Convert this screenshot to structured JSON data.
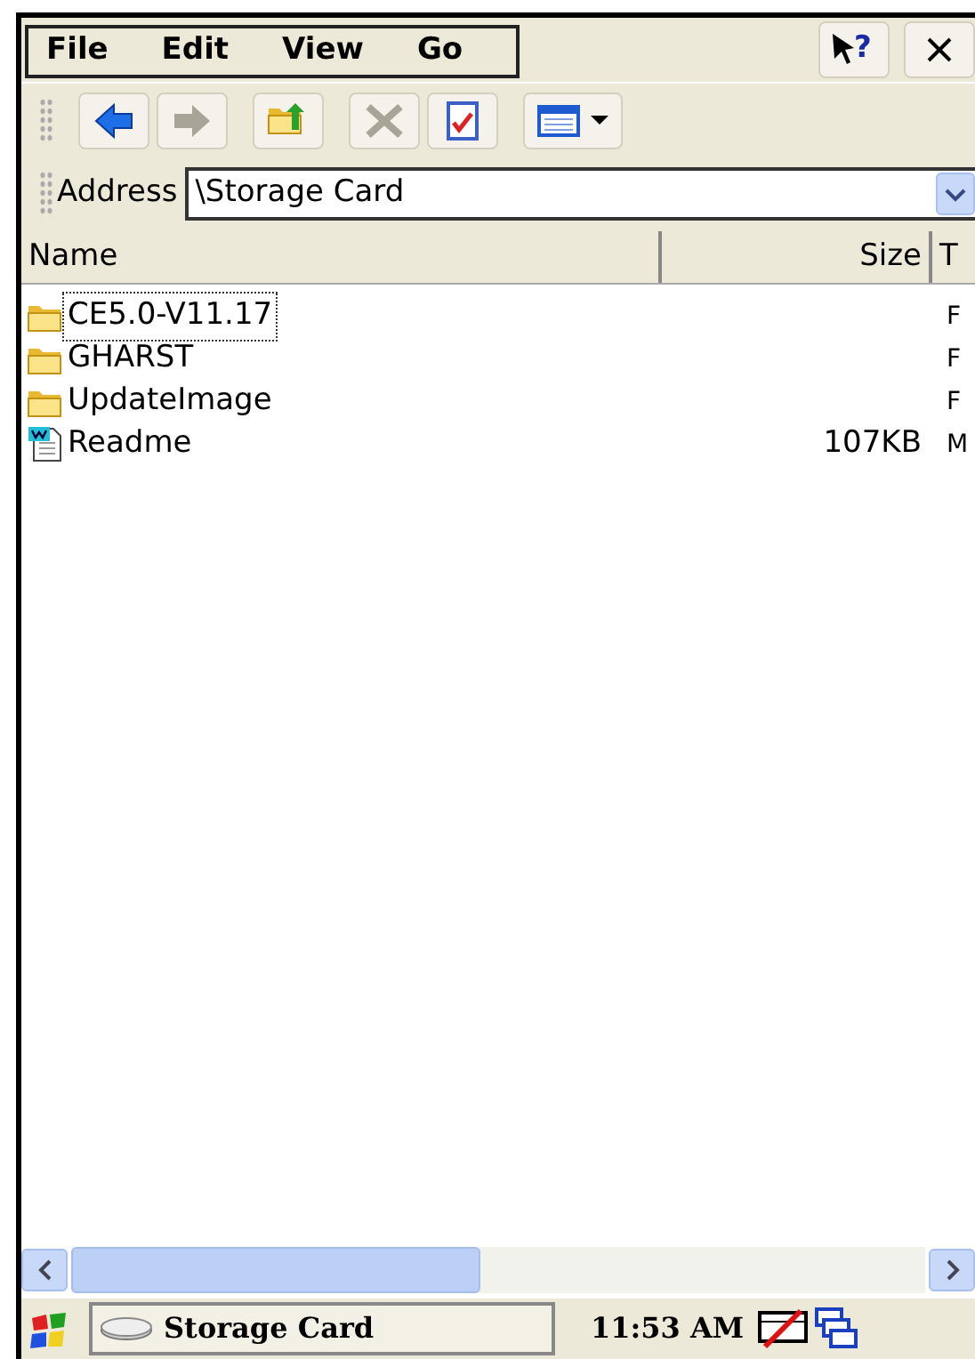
{
  "menu_bar": {
    "items": [
      "File",
      "Edit",
      "View",
      "Go"
    ],
    "help_glyph": "?"
  },
  "address_bar": {
    "label": "Address",
    "value": "\\Storage Card"
  },
  "file_list": {
    "columns": [
      "Name",
      "Size",
      "T"
    ],
    "rows": [
      {
        "kind": "folder",
        "name": "CE5.0-V11.17",
        "size": "",
        "column_3": "F",
        "selected": true
      },
      {
        "kind": "folder",
        "name": "GHARST",
        "size": "",
        "column_3": "F",
        "selected": false
      },
      {
        "kind": "folder",
        "name": "UpdateImage",
        "size": "",
        "column_3": "F",
        "selected": false
      },
      {
        "kind": "document",
        "name": "Readme",
        "size": "107KB",
        "column_3": "M",
        "selected": false
      }
    ]
  },
  "taskbar": {
    "task": "Storage Card",
    "clock": "11:53 AM"
  }
}
